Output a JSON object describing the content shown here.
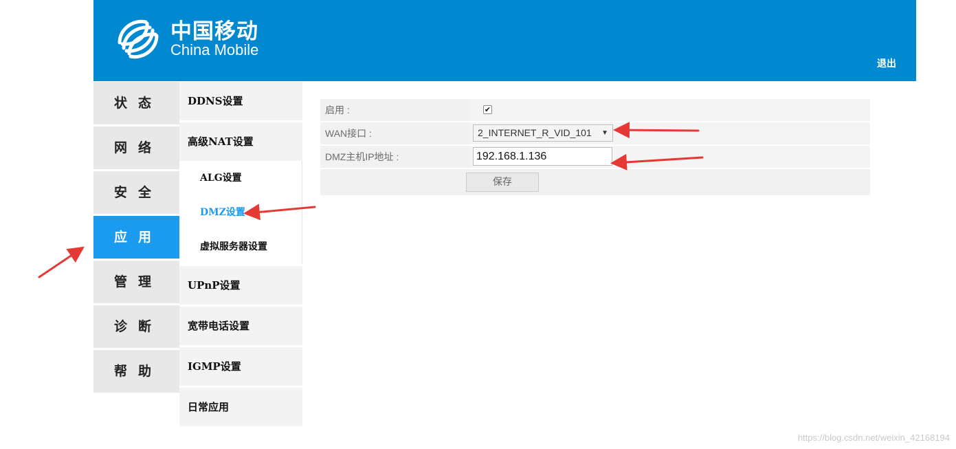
{
  "header": {
    "logo_cn": "中国移动",
    "logo_en": "China Mobile",
    "logout_label": "退出",
    "brand_color": "#0088d0"
  },
  "main_menu": {
    "items": [
      {
        "label": "状态"
      },
      {
        "label": "网络"
      },
      {
        "label": "安全"
      },
      {
        "label": "应用",
        "active": true
      },
      {
        "label": "管理"
      },
      {
        "label": "诊断"
      },
      {
        "label": "帮助"
      }
    ],
    "active_color": "#1a9bef"
  },
  "sub_menu": {
    "items": [
      {
        "label": "DDNS设置"
      },
      {
        "label": "高级NAT设置",
        "expanded": true,
        "children": [
          {
            "label": "ALG设置"
          },
          {
            "label": "DMZ设置",
            "active": true
          },
          {
            "label": "虚拟服务器设置"
          }
        ]
      },
      {
        "label": "UPnP设置"
      },
      {
        "label": "宽带电话设置"
      },
      {
        "label": "IGMP设置"
      },
      {
        "label": "日常应用"
      }
    ]
  },
  "form": {
    "enable_label": "启用 :",
    "enable_checked": true,
    "wan_label": "WAN接口 :",
    "wan_value": "2_INTERNET_R_VID_101",
    "dmz_ip_label": "DMZ主机IP地址 :",
    "dmz_ip_value": "192.168.1.136",
    "save_label": "保存"
  },
  "watermark": "https://blog.csdn.net/weixin_42168194"
}
